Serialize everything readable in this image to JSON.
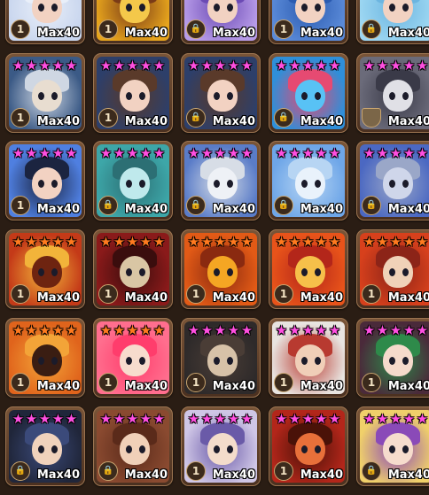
{
  "level_label": "Max40",
  "colors": {
    "star_pink": "#ff4fe1",
    "star_orange": "#ff7a1f"
  },
  "rows": [
    [
      {
        "name": "monster-white-hair",
        "stars": 0,
        "badge": "1",
        "badge_type": "number",
        "palette": [
          "#c9d6ee",
          "#f2d2c2",
          "#e9eff9"
        ]
      },
      {
        "name": "monster-pumpkin",
        "stars": 0,
        "badge": "1",
        "badge_type": "number",
        "palette": [
          "#e7a51d",
          "#f4c84a",
          "#7a3b17"
        ]
      },
      {
        "name": "monster-purple-hair",
        "stars": 0,
        "badge": "lock",
        "badge_type": "lock",
        "palette": [
          "#b79be8",
          "#f2d2c2",
          "#6b4ab4"
        ]
      },
      {
        "name": "monster-blue-hair",
        "stars": 0,
        "badge": "1",
        "badge_type": "number",
        "palette": [
          "#5a8ad8",
          "#f2d2c2",
          "#2b5bb0"
        ]
      },
      {
        "name": "monster-light-blue",
        "stars": 0,
        "badge": "lock",
        "badge_type": "lock",
        "palette": [
          "#9dd7f2",
          "#f2d2c2",
          "#6cb5e0"
        ]
      }
    ],
    [
      {
        "name": "monster-hooded-mage",
        "stars": 5,
        "star_color": "pink",
        "badge": "1",
        "badge_type": "number",
        "palette": [
          "#3b5a86",
          "#e8ddd0",
          "#cfd7e3"
        ]
      },
      {
        "name": "monster-blue-vest-boy",
        "stars": 5,
        "star_color": "pink",
        "badge": "1",
        "badge_type": "number",
        "palette": [
          "#2d3f6a",
          "#f2d2c2",
          "#5a3a2a"
        ]
      },
      {
        "name": "monster-blue-vest-boy-2",
        "stars": 5,
        "star_color": "pink",
        "badge": "lock",
        "badge_type": "lock",
        "palette": [
          "#2d3f6a",
          "#f2d2c2",
          "#5a3a2a"
        ]
      },
      {
        "name": "monster-blue-beast",
        "stars": 5,
        "star_color": "pink",
        "badge": "lock",
        "badge_type": "lock",
        "palette": [
          "#2f8fd9",
          "#58c2f5",
          "#e64a72"
        ]
      },
      {
        "name": "monster-skull-knight",
        "stars": 5,
        "star_color": "pink",
        "badge": "shield",
        "badge_type": "shield",
        "palette": [
          "#6b6b7a",
          "#e0e0e6",
          "#3a3a48"
        ]
      }
    ],
    [
      {
        "name": "monster-dark-hair-boy",
        "stars": 5,
        "star_color": "pink",
        "badge": "1",
        "badge_type": "number",
        "palette": [
          "#4f7fe0",
          "#f2d2c2",
          "#1b2440"
        ]
      },
      {
        "name": "monster-teal-cat",
        "stars": 5,
        "star_color": "pink",
        "badge": "lock",
        "badge_type": "lock",
        "palette": [
          "#3da6a8",
          "#bfe9ec",
          "#2c6f74"
        ]
      },
      {
        "name": "monster-white-ninja",
        "stars": 5,
        "star_color": "pink",
        "badge": "lock",
        "badge_type": "lock",
        "palette": [
          "#5a7cc8",
          "#eef1f6",
          "#d7dde6"
        ]
      },
      {
        "name": "monster-ice-mage",
        "stars": 5,
        "star_color": "pink",
        "badge": "lock",
        "badge_type": "lock",
        "palette": [
          "#6ea6e8",
          "#e9f2fb",
          "#b7d5f3"
        ]
      },
      {
        "name": "monster-silver-wolf",
        "stars": 5,
        "star_color": "pink",
        "badge": "lock",
        "badge_type": "lock",
        "palette": [
          "#4b68c2",
          "#cfd6ea",
          "#9aa7c8"
        ]
      }
    ],
    [
      {
        "name": "monster-fire-demon",
        "stars": 5,
        "star_color": "orange",
        "badge": "1",
        "badge_type": "number",
        "palette": [
          "#c43a18",
          "#6e2410",
          "#f2b43a"
        ]
      },
      {
        "name": "monster-red-skull",
        "stars": 5,
        "star_color": "orange",
        "badge": "1",
        "badge_type": "number",
        "palette": [
          "#8a1a1a",
          "#d9c6a4",
          "#3a0d0d"
        ]
      },
      {
        "name": "monster-fire-beast",
        "stars": 5,
        "star_color": "orange",
        "badge": "1",
        "badge_type": "number",
        "palette": [
          "#e25a16",
          "#f5a623",
          "#8a2a10"
        ]
      },
      {
        "name": "monster-phoenix",
        "stars": 5,
        "star_color": "orange",
        "badge": "1",
        "badge_type": "number",
        "palette": [
          "#e8531a",
          "#f6c04a",
          "#b3261a"
        ]
      },
      {
        "name": "monster-fire-dragon",
        "stars": 5,
        "star_color": "orange",
        "badge": "1",
        "badge_type": "number",
        "palette": [
          "#d7401c",
          "#f0d2b8",
          "#8c2418"
        ]
      }
    ],
    [
      {
        "name": "monster-lava-golem",
        "stars": 5,
        "star_color": "orange",
        "badge": "1",
        "badge_type": "number",
        "palette": [
          "#e0641c",
          "#3a1d12",
          "#f3a438"
        ]
      },
      {
        "name": "monster-pink-hair-girl",
        "stars": 5,
        "star_color": "orange",
        "badge": "1",
        "badge_type": "number",
        "palette": [
          "#ff6e8e",
          "#f7dccd",
          "#ff3d6c"
        ]
      },
      {
        "name": "monster-dark-cloak",
        "stars": 5,
        "star_color": "pink",
        "badge": "1",
        "badge_type": "number",
        "palette": [
          "#2e2a2a",
          "#d7c2a8",
          "#4a3d36"
        ]
      },
      {
        "name": "monster-white-hair-fighter",
        "stars": 5,
        "star_color": "pink",
        "badge": "1",
        "badge_type": "number",
        "palette": [
          "#e8e4e0",
          "#f0cfb8",
          "#b83a30"
        ]
      },
      {
        "name": "monster-bamboo-girl",
        "stars": 5,
        "star_color": "pink",
        "badge": "1",
        "badge_type": "number",
        "palette": [
          "#4a2a3a",
          "#f5dacb",
          "#2e8a4a"
        ]
      }
    ],
    [
      {
        "name": "monster-black-hair-boy",
        "stars": 5,
        "star_color": "pink",
        "badge": "lock",
        "badge_type": "lock",
        "palette": [
          "#20263a",
          "#f0d2bc",
          "#3b4a7a"
        ]
      },
      {
        "name": "monster-brown-hair-boy",
        "stars": 5,
        "star_color": "pink",
        "badge": "lock",
        "badge_type": "lock",
        "palette": [
          "#8a4a30",
          "#f0d0b8",
          "#5a2a1a"
        ]
      },
      {
        "name": "monster-goggles-boy",
        "stars": 5,
        "star_color": "pink",
        "badge": "1",
        "badge_type": "number",
        "palette": [
          "#cfc6e6",
          "#f3dccb",
          "#6a5aa8"
        ]
      },
      {
        "name": "monster-red-dragon",
        "stars": 5,
        "star_color": "pink",
        "badge": "1",
        "badge_type": "number",
        "palette": [
          "#b3261a",
          "#e8703a",
          "#4a1208"
        ]
      },
      {
        "name": "monster-flower-girl",
        "stars": 5,
        "star_color": "pink",
        "badge": "lock",
        "badge_type": "lock",
        "palette": [
          "#f0d06a",
          "#f6dccd",
          "#8a4ab8"
        ]
      }
    ]
  ]
}
